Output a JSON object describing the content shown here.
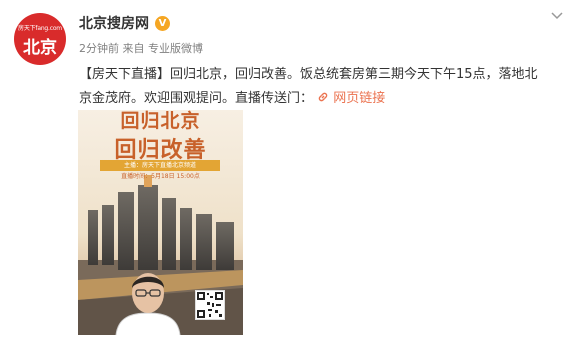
{
  "account": {
    "avatar_brand_text": "房天下fang.com",
    "avatar_city_text": "北京",
    "name": "北京搜房网",
    "verified_badge": "V"
  },
  "meta": {
    "time": "2分钟前",
    "source_prefix": "来自",
    "source": "专业版微博"
  },
  "post": {
    "text": "【房天下直播】回归北京，回归改善。饭总统套房第三期今天下午15点，落地北京金茂府。欢迎围观提问。直播传送门：",
    "link_icon": "link-icon",
    "link_label": "网页链接"
  },
  "poster": {
    "title_line1": "回归北京",
    "title_line2": "回归改善",
    "banner": "主播：房天下直播北京频道",
    "time_line": "直播时间：5月18日 15:00点"
  },
  "colors": {
    "accent": "#eb7350",
    "avatar_bg": "#d92b2b",
    "verified": "#f5a623",
    "poster_title": "#c8612a"
  }
}
